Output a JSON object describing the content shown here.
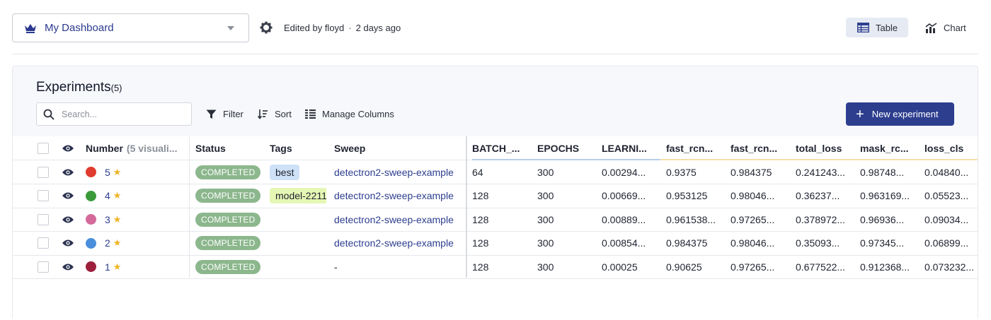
{
  "topbar": {
    "dashboard_name": "My Dashboard",
    "edited_by": "Edited by floyd",
    "edited_when": "2 days ago",
    "view_table": "Table",
    "view_chart": "Chart"
  },
  "panel": {
    "title": "Experiments",
    "count": "(5)",
    "search_placeholder": "Search...",
    "filter": "Filter",
    "sort": "Sort",
    "manage_columns": "Manage Columns",
    "new_experiment": "New experiment"
  },
  "columns": {
    "number": "Number",
    "number_hint": "(5 visuali...",
    "status": "Status",
    "tags": "Tags",
    "sweep": "Sweep",
    "batch": "BATCH_...",
    "epochs": "EPOCHS",
    "learning": "LEARNI...",
    "fast1": "fast_rcn...",
    "fast2": "fast_rcn...",
    "total_loss": "total_loss",
    "mask": "mask_rc...",
    "loss_cls": "loss_cls"
  },
  "rows": [
    {
      "num": "5",
      "color": "#e03b2e",
      "status": "COMPLETED",
      "tag": "best",
      "sweep": "detectron2-sweep-example",
      "batch": "64",
      "epochs": "300",
      "lr": "0.00294...",
      "fast1": "0.9375",
      "fast2": "0.984375",
      "total_loss": "0.241243...",
      "mask": "0.98748...",
      "loss_cls": "0.04840..."
    },
    {
      "num": "4",
      "color": "#3a9a3a",
      "status": "COMPLETED",
      "tag": "model-2211",
      "sweep": "detectron2-sweep-example",
      "batch": "128",
      "epochs": "300",
      "lr": "0.00669...",
      "fast1": "0.953125",
      "fast2": "0.98046...",
      "total_loss": "0.36237...",
      "mask": "0.963169...",
      "loss_cls": "0.05523..."
    },
    {
      "num": "3",
      "color": "#d46a9a",
      "status": "COMPLETED",
      "tag": "",
      "sweep": "detectron2-sweep-example",
      "batch": "128",
      "epochs": "300",
      "lr": "0.00889...",
      "fast1": "0.961538...",
      "fast2": "0.97265...",
      "total_loss": "0.378972...",
      "mask": "0.96936...",
      "loss_cls": "0.09034..."
    },
    {
      "num": "2",
      "color": "#4a8fdc",
      "status": "COMPLETED",
      "tag": "",
      "sweep": "detectron2-sweep-example",
      "batch": "128",
      "epochs": "300",
      "lr": "0.00854...",
      "fast1": "0.984375",
      "fast2": "0.98046...",
      "total_loss": "0.35093...",
      "mask": "0.97345...",
      "loss_cls": "0.06899..."
    },
    {
      "num": "1",
      "color": "#9c1f3c",
      "status": "COMPLETED",
      "tag": "",
      "sweep": "-",
      "batch": "128",
      "epochs": "300",
      "lr": "0.00025",
      "fast1": "0.90625",
      "fast2": "0.97265...",
      "total_loss": "0.677522...",
      "mask": "0.912368...",
      "loss_cls": "0.073232..."
    }
  ],
  "colors": {
    "accent": "#2d3e8f",
    "status_green": "#8cb78d",
    "star": "#f0b323"
  }
}
